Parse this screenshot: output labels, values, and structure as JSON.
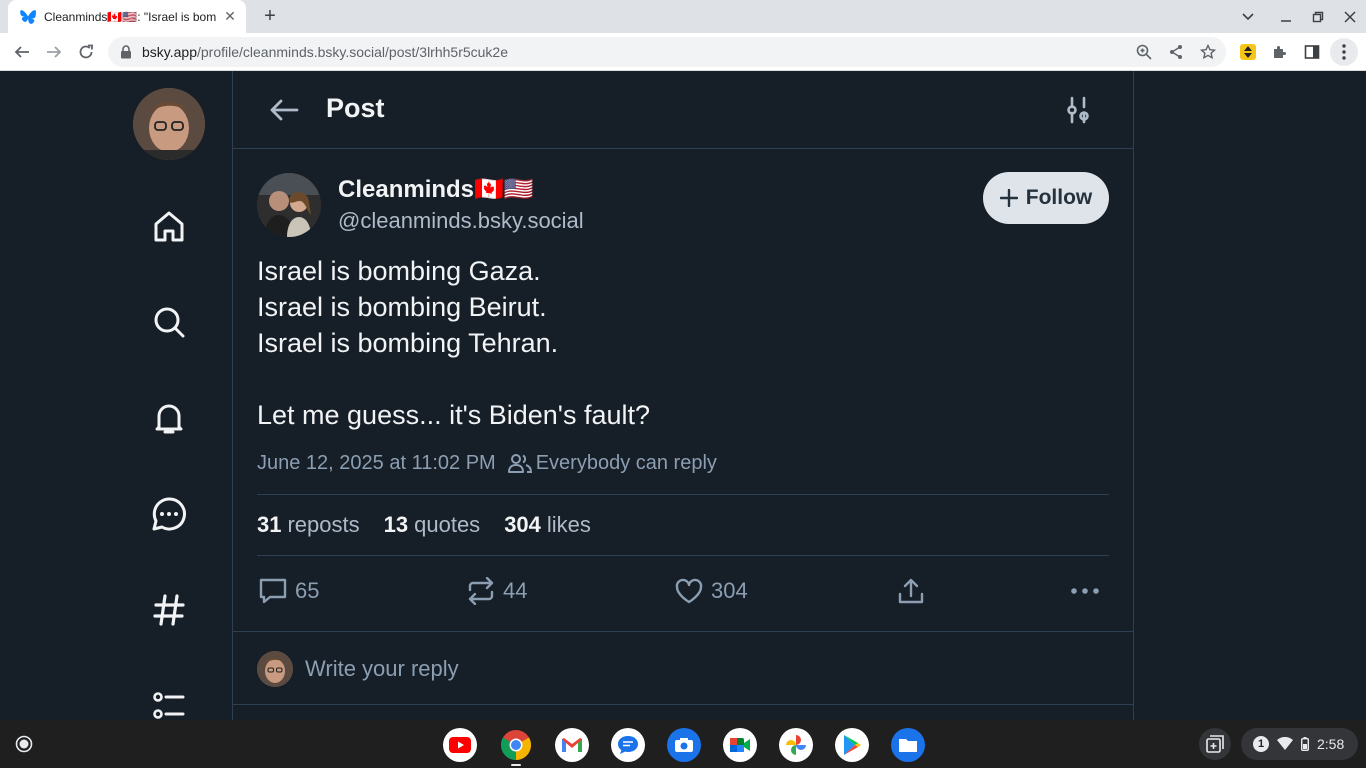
{
  "browser": {
    "tab_title": "Cleanminds🇨🇦🇺🇸: \"Israel is bombing Gaza...",
    "url_host": "bsky.app",
    "url_path": "/profile/cleanminds.bsky.social/post/3lrhh5r5cuk2e"
  },
  "header": {
    "title": "Post"
  },
  "post": {
    "author_name": "Cleanminds🇨🇦🇺🇸",
    "author_handle": "@cleanminds.bsky.social",
    "follow_label": "Follow",
    "lines": [
      "Israel is bombing Gaza.",
      "Israel is bombing Beirut.",
      "Israel is bombing Tehran.",
      "",
      "Let me guess... it's Biden's fault?"
    ],
    "timestamp": "June 12, 2025 at 11:02 PM",
    "reply_setting": "Everybody can reply",
    "stats": {
      "reposts_count": "31",
      "reposts_label": "reposts",
      "quotes_count": "13",
      "quotes_label": "quotes",
      "likes_count": "304",
      "likes_label": "likes"
    },
    "actions": {
      "replies": "65",
      "reposts": "44",
      "likes": "304"
    }
  },
  "reply": {
    "placeholder": "Write your reply"
  },
  "shelf": {
    "time": "2:58",
    "notification_count": "1",
    "apps": [
      "youtube-icon",
      "chrome-icon",
      "gmail-icon",
      "messages-icon",
      "camera-icon",
      "meet-icon",
      "photos-icon",
      "play-store-icon",
      "files-icon"
    ]
  },
  "colors": {
    "page_bg": "#161e27",
    "border": "#2e4052",
    "text_primary": "#f1f3f5",
    "text_secondary": "#8c9eb2",
    "follow_bg": "#dfe4ea",
    "bluesky_blue": "#1185fe"
  }
}
